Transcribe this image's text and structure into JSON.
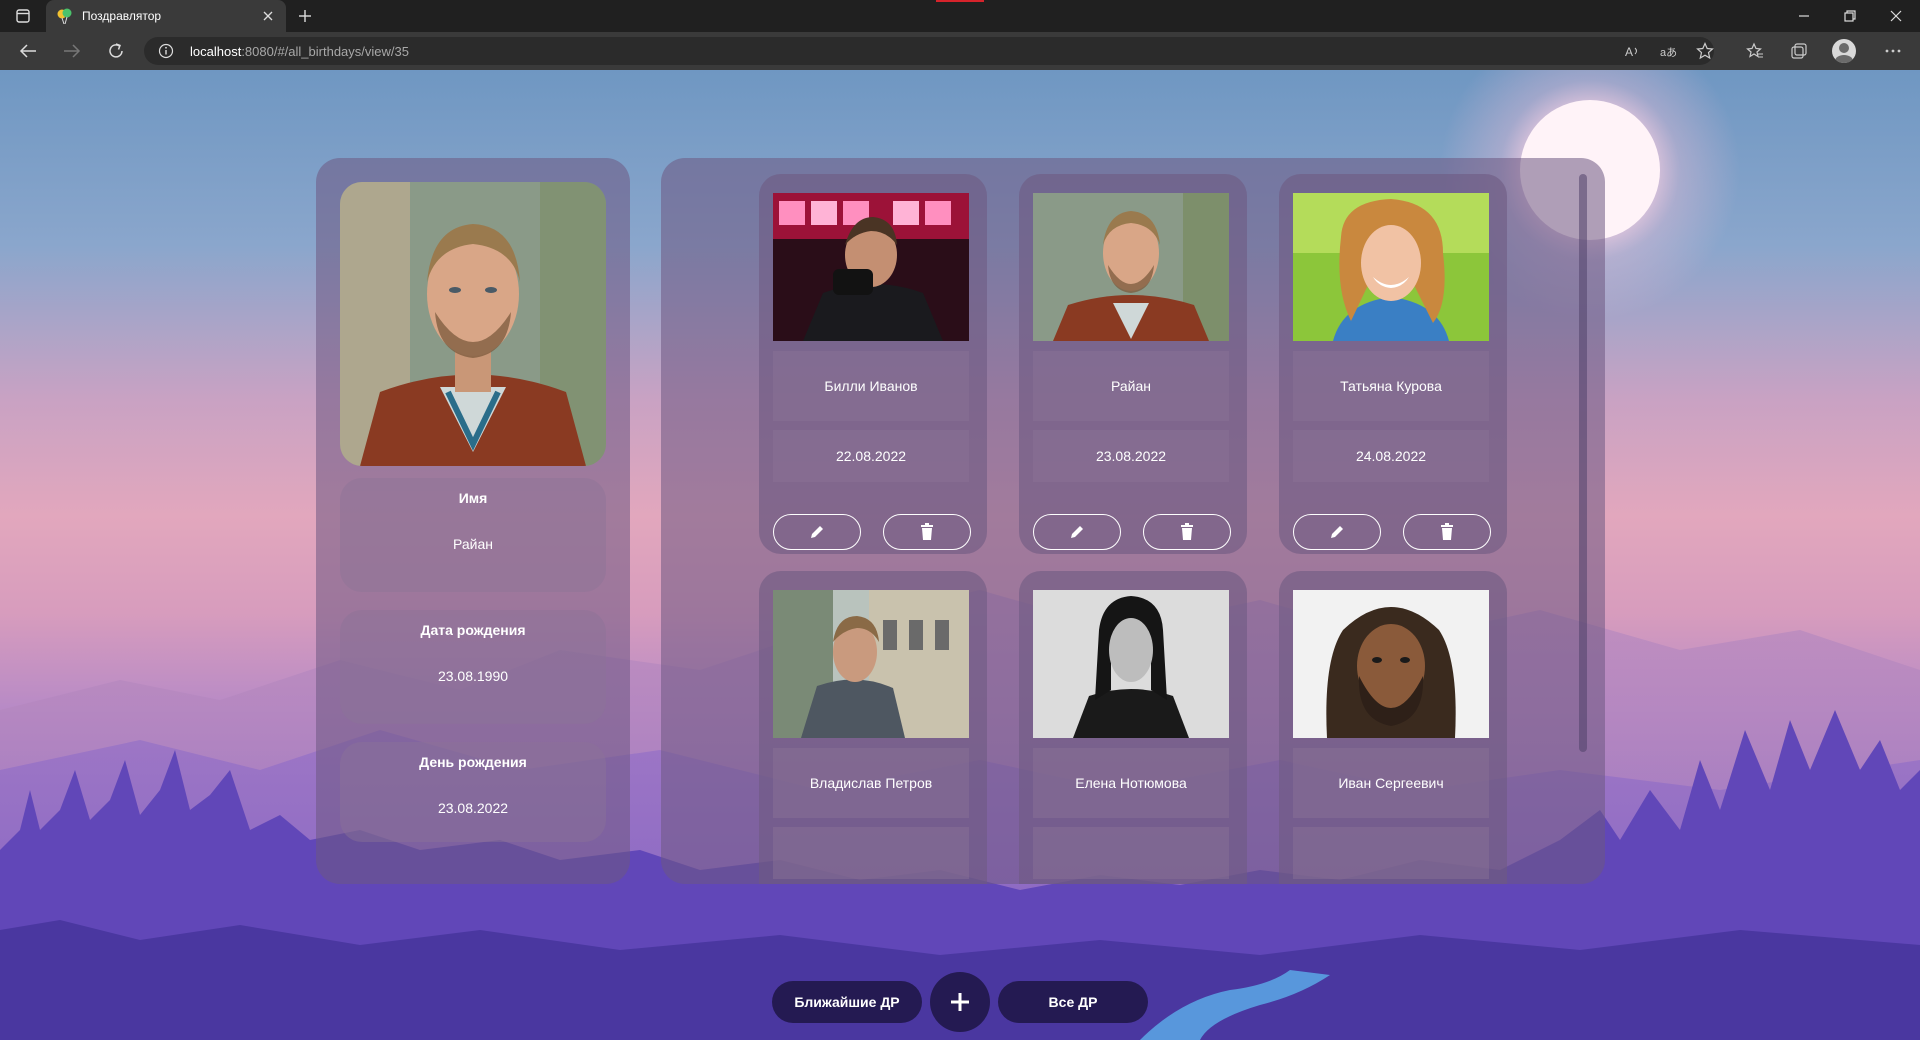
{
  "browser": {
    "tab_title": "Поздравлятор",
    "url_host": "localhost",
    "url_path": ":8080/#/all_birthdays/view/35"
  },
  "detail": {
    "name_label": "Имя",
    "name_value": "Райан",
    "birthdate_label": "Дата рождения",
    "birthdate_value": "23.08.1990",
    "birthday_label": "День рождения",
    "birthday_value": "23.08.2022"
  },
  "cards": [
    {
      "name": "Билли Иванов",
      "date": "22.08.2022",
      "photo": "man-red-stage"
    },
    {
      "name": "Райан",
      "date": "23.08.2022",
      "photo": "man-brown-jacket"
    },
    {
      "name": "Татьяна Курова",
      "date": "24.08.2022",
      "photo": "smiling-woman"
    },
    {
      "name": "Владислав Петров",
      "date": "",
      "photo": "man-grey-jacket-street"
    },
    {
      "name": "Елена Нотюмова",
      "date": "",
      "photo": "woman-black-white"
    },
    {
      "name": "Иван Сергеевич",
      "date": "",
      "photo": "neanderthal-reconstruction"
    }
  ],
  "bottom_nav": {
    "upcoming_label": "Ближайшие ДР",
    "all_label": "Все ДР",
    "add_icon": "plus-icon"
  },
  "colors": {
    "panel": "#6e5882",
    "nav_pill": "#241a52",
    "sky_top": "#6f97c2",
    "sky_pink": "#e2a7bd",
    "mountain_purple": "#5b49b0"
  }
}
